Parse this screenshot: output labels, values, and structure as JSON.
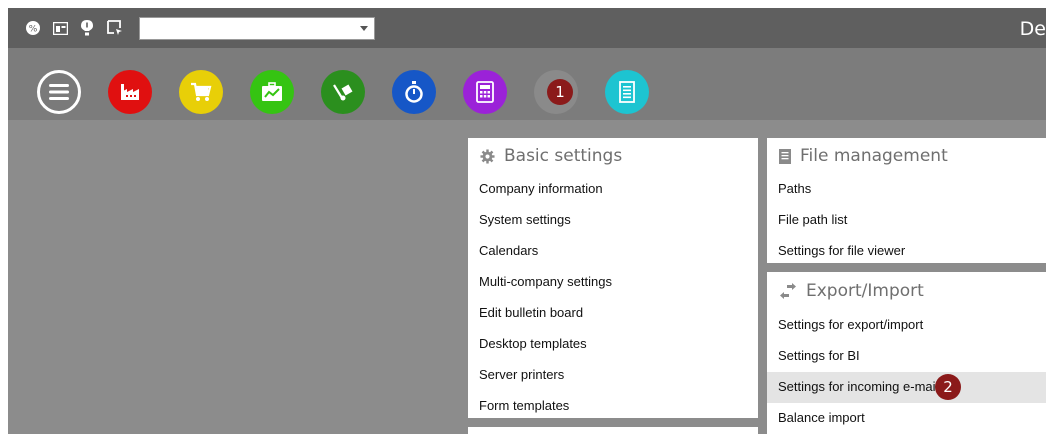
{
  "topbar": {
    "user_text": "De",
    "combo_value": "",
    "icons": [
      "percent-circle-icon",
      "window-icon",
      "alert-icon",
      "pointer-screen-icon"
    ]
  },
  "ribbon": {
    "buttons": [
      {
        "name": "main-menu-button",
        "icon": "hamburger-icon",
        "color": "#7a7a7a"
      },
      {
        "name": "production-button",
        "icon": "factory-icon",
        "color": "#e01010"
      },
      {
        "name": "purchase-button",
        "icon": "cart-icon",
        "color": "#e8cf08"
      },
      {
        "name": "sales-button",
        "icon": "briefcase-chart-icon",
        "color": "#35c412"
      },
      {
        "name": "logistics-button",
        "icon": "hand-truck-icon",
        "color": "#2b8f1e"
      },
      {
        "name": "time-button",
        "icon": "stopwatch-icon",
        "color": "#1657c7"
      },
      {
        "name": "finance-button",
        "icon": "calculator-icon",
        "color": "#9b22d8"
      },
      {
        "name": "settings-button",
        "icon": "gear-icon",
        "color": "#8a8a8a"
      },
      {
        "name": "documents-button",
        "icon": "document-icon",
        "color": "#1dc4d1"
      }
    ]
  },
  "badges": {
    "one": "1",
    "two": "2"
  },
  "basic_settings": {
    "title": "Basic settings",
    "items": [
      "Company information",
      "System settings",
      "Calendars",
      "Multi-company settings",
      "Edit bulletin board",
      "Desktop templates",
      "Server printers",
      "Form templates"
    ]
  },
  "file_management": {
    "title": "File management",
    "items": [
      "Paths",
      "File path list",
      "Settings for file viewer"
    ]
  },
  "export_import": {
    "title": "Export/Import",
    "items": [
      "Settings for export/import",
      "Settings for BI",
      "Settings for incoming e-mail",
      "Balance import"
    ],
    "highlighted": "Settings for incoming e-mail"
  }
}
